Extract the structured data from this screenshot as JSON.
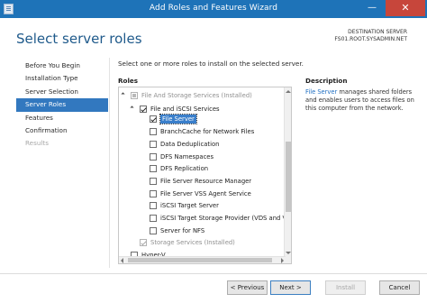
{
  "window": {
    "title": "Add Roles and Features Wizard",
    "minimize_glyph": "—",
    "close_glyph": "✕"
  },
  "header": {
    "page_title": "Select server roles",
    "destination_label": "DESTINATION SERVER",
    "destination_server": "FS01.ROOT.SYSADMIN.NET"
  },
  "nav": {
    "items": [
      {
        "label": "Before You Begin",
        "state": "normal"
      },
      {
        "label": "Installation Type",
        "state": "normal"
      },
      {
        "label": "Server Selection",
        "state": "normal"
      },
      {
        "label": "Server Roles",
        "state": "active"
      },
      {
        "label": "Features",
        "state": "normal"
      },
      {
        "label": "Confirmation",
        "state": "normal"
      },
      {
        "label": "Results",
        "state": "disabled"
      }
    ]
  },
  "main": {
    "instruction": "Select one or more roles to install on the selected server.",
    "roles_label": "Roles",
    "description_label": "Description",
    "description_link": "File Server",
    "description_text": " manages shared folders and enables users to access files on this computer from the network."
  },
  "roles": [
    {
      "label": "File And Storage Services (Installed)",
      "state": "partial",
      "expander": "open"
    },
    {
      "label": "File and iSCSI Services",
      "state": "checked",
      "expander": "open"
    },
    {
      "label": "File Server",
      "state": "checked",
      "selected": true
    },
    {
      "label": "BranchCache for Network Files",
      "state": "unchecked"
    },
    {
      "label": "Data Deduplication",
      "state": "unchecked"
    },
    {
      "label": "DFS Namespaces",
      "state": "unchecked"
    },
    {
      "label": "DFS Replication",
      "state": "unchecked"
    },
    {
      "label": "File Server Resource Manager",
      "state": "unchecked"
    },
    {
      "label": "File Server VSS Agent Service",
      "state": "unchecked"
    },
    {
      "label": "iSCSI Target Server",
      "state": "unchecked"
    },
    {
      "label": "iSCSI Target Storage Provider (VDS and VSS",
      "state": "unchecked"
    },
    {
      "label": "Server for NFS",
      "state": "unchecked"
    },
    {
      "label": "Storage Services (Installed)",
      "state": "installed"
    },
    {
      "label": "Hyper-V",
      "state": "unchecked"
    }
  ],
  "buttons": {
    "previous": "< Previous",
    "next": "Next >",
    "install": "Install",
    "cancel": "Cancel"
  }
}
